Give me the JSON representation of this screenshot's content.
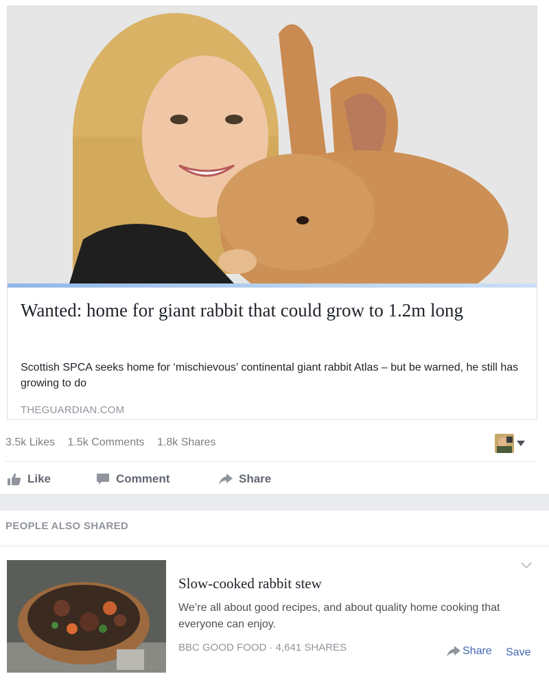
{
  "link_card": {
    "title": "Wanted: home for giant rabbit that could grow to 1.2m long",
    "description": "Scottish SPCA seeks home for ‘mischievous’ continental giant rabbit Atlas – but be warned, he still has growing to do",
    "domain": "THEGUARDIAN.COM"
  },
  "stats": {
    "likes": "3.5k Likes",
    "comments": "1.5k Comments",
    "shares": "1.8k Shares"
  },
  "actions": {
    "like": "Like",
    "comment": "Comment",
    "share": "Share"
  },
  "people_also_shared": {
    "header": "PEOPLE ALSO SHARED",
    "item": {
      "title": "Slow-cooked rabbit stew",
      "description": "We’re all about good recipes, and about quality home cooking that everyone can enjoy.",
      "source": "BBC GOOD FOOD · 4,641 SHARES",
      "share_label": "Share",
      "save_label": "Save"
    }
  },
  "colors": {
    "link_blue": "#4267b2",
    "muted_gray": "#90949c",
    "action_gray": "#616770"
  },
  "icons": [
    "like-icon",
    "comment-icon",
    "share-icon",
    "chevron-down-icon",
    "caret-down-icon",
    "avatar"
  ]
}
